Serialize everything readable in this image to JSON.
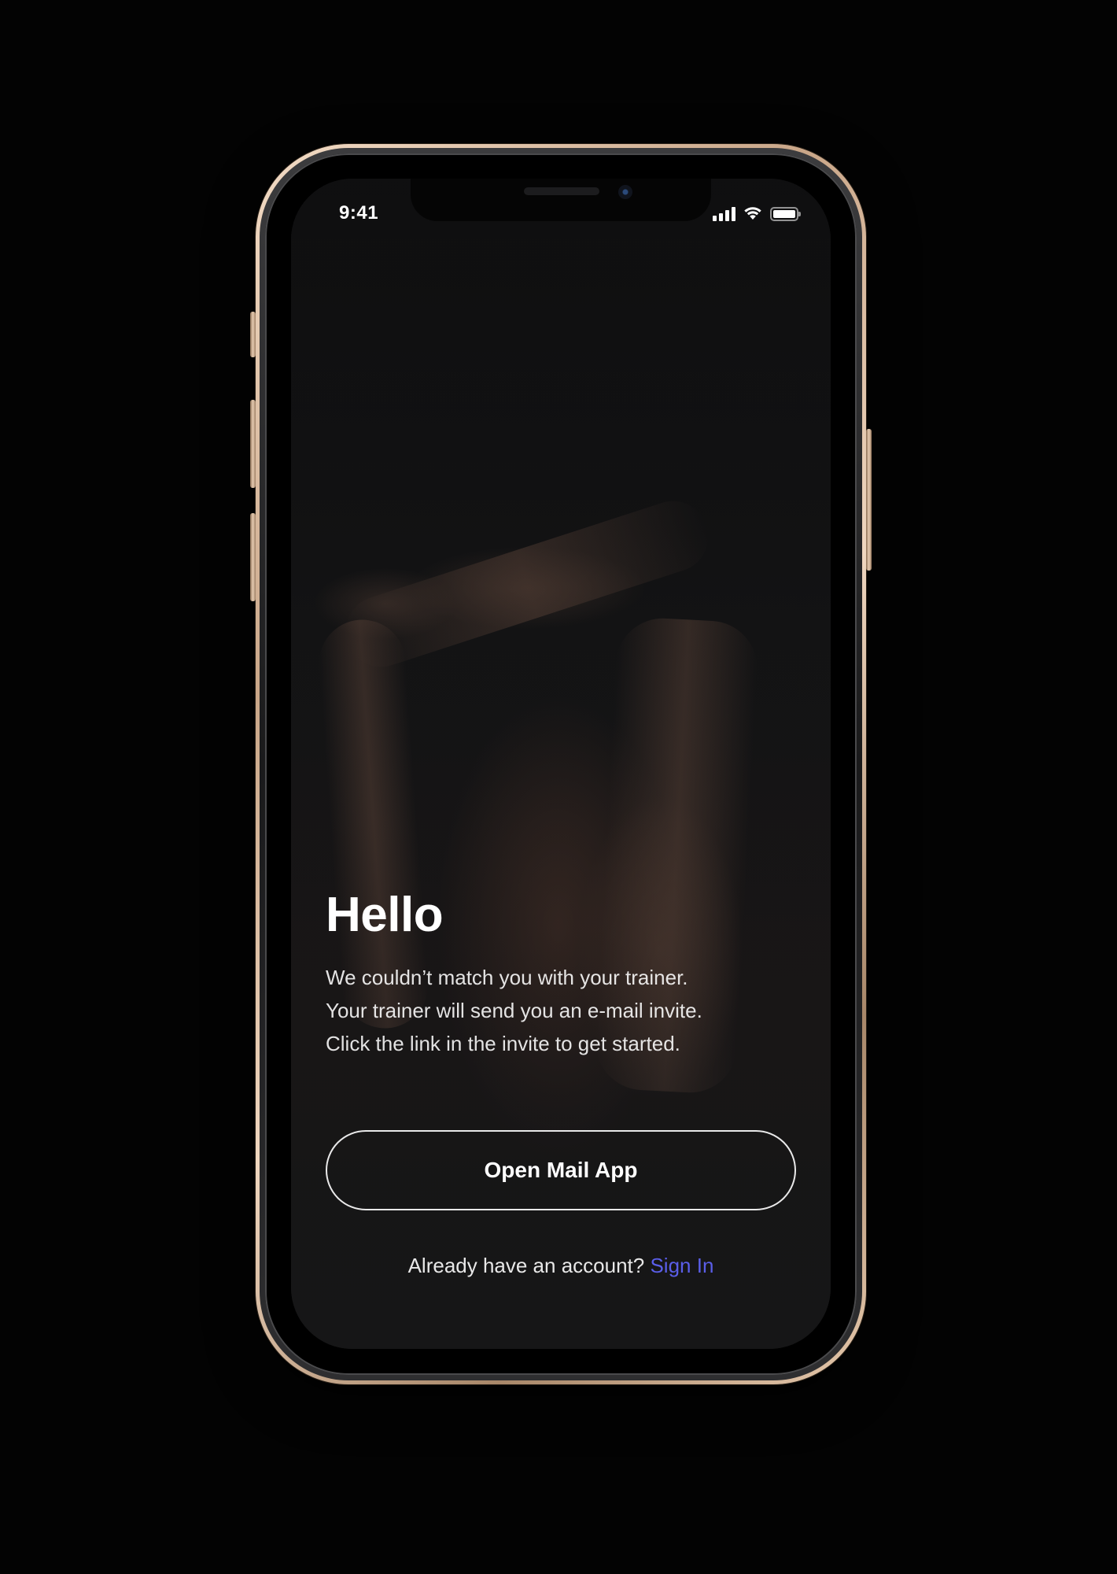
{
  "status_bar": {
    "time": "9:41",
    "icons": [
      "cellular-signal-icon",
      "wifi-icon",
      "battery-icon"
    ]
  },
  "content": {
    "title": "Hello",
    "message": "We couldn’t match you with your trainer. Your trainer will send you an e-mail invite. Click the link in the invite to get started."
  },
  "primary_button": {
    "label": "Open Mail App"
  },
  "signin": {
    "prompt": "Already have an account?",
    "link_label": "Sign In"
  },
  "colors": {
    "background": "#030303",
    "screen_background": "#121213",
    "text": "#ffffff",
    "link": "#5a5ee8",
    "button_border": "#e9e9e9"
  }
}
